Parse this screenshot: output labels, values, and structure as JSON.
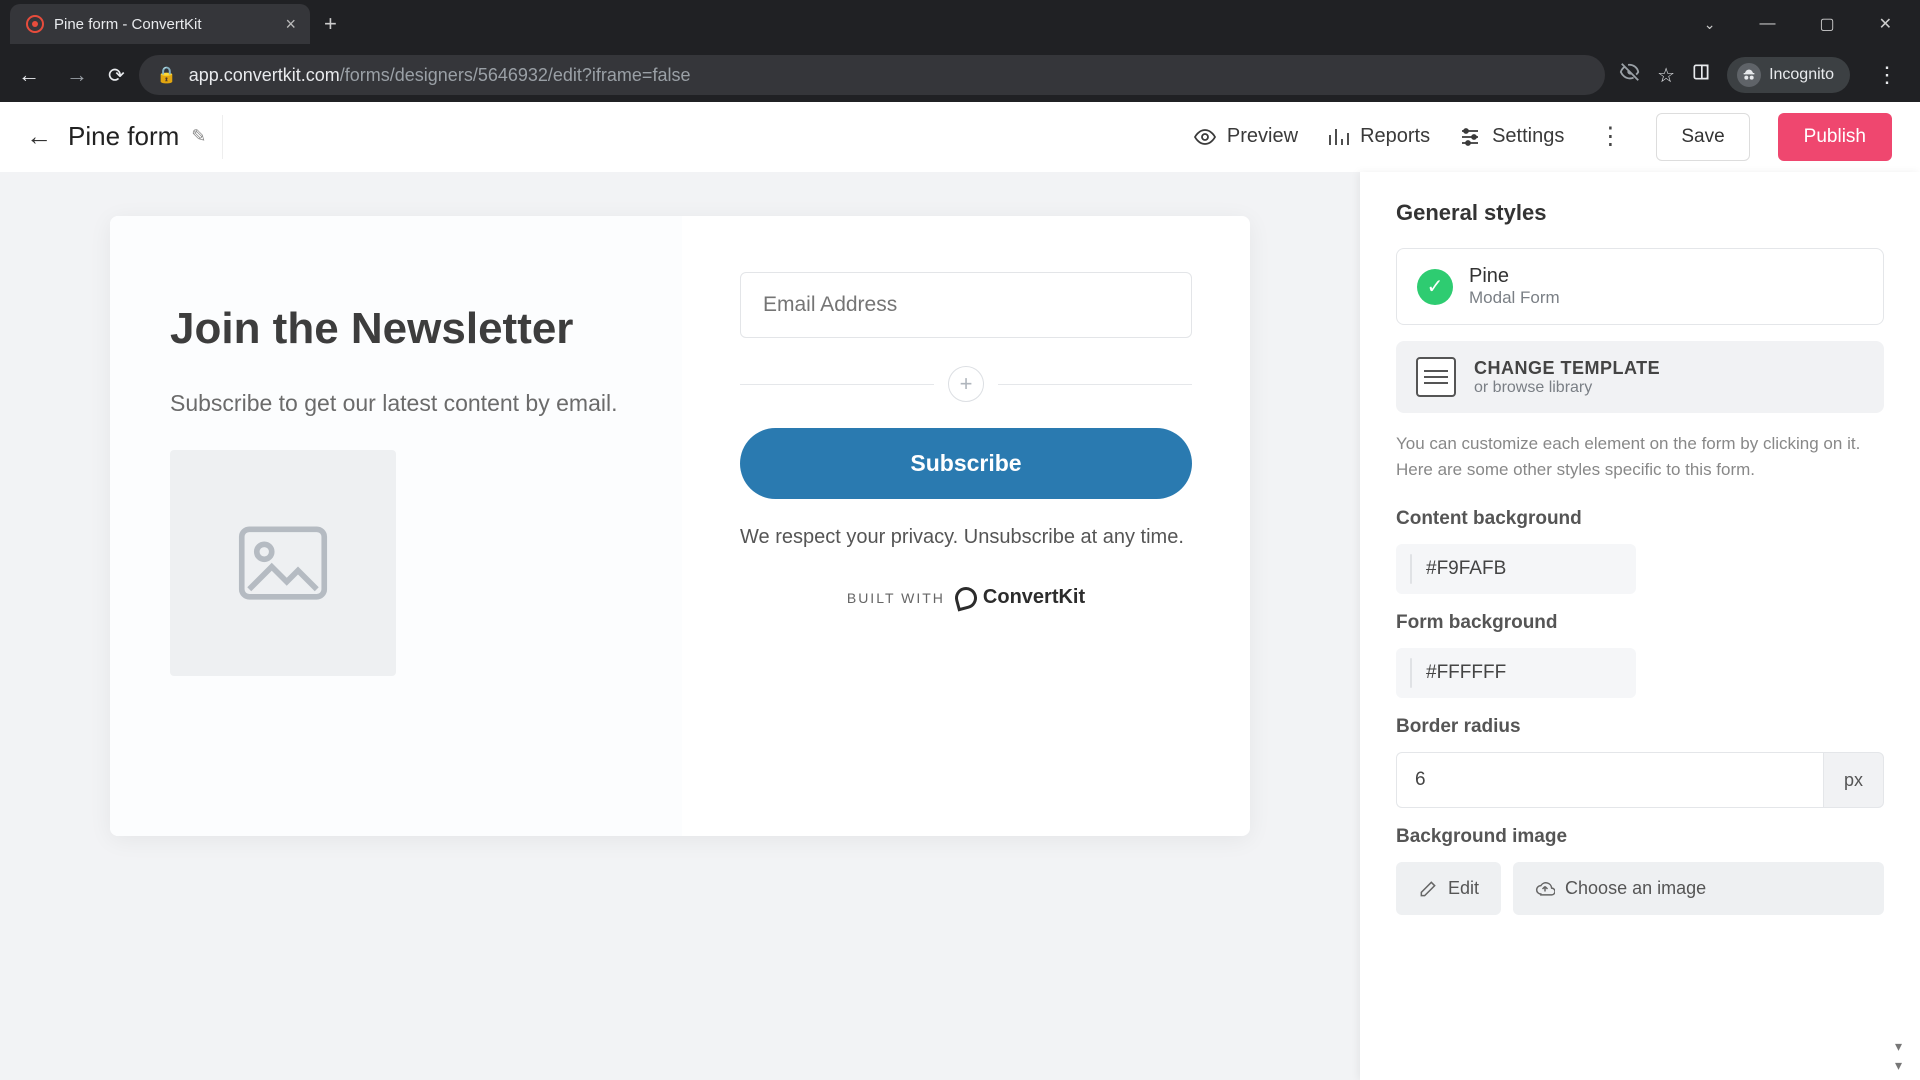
{
  "browser": {
    "tab_title": "Pine form - ConvertKit",
    "url_domain": "app.convertkit.com",
    "url_path": "/forms/designers/5646932/edit?iframe=false",
    "incognito_label": "Incognito"
  },
  "header": {
    "form_name": "Pine form",
    "preview": "Preview",
    "reports": "Reports",
    "settings": "Settings",
    "save": "Save",
    "publish": "Publish"
  },
  "form_preview": {
    "heading": "Join the Newsletter",
    "subheading": "Subscribe to get our latest content by email.",
    "email_placeholder": "Email Address",
    "subscribe_label": "Subscribe",
    "privacy": "We respect your privacy. Unsubscribe at any time.",
    "built_with_prefix": "BUILT WITH",
    "brand": "ConvertKit"
  },
  "panel": {
    "title": "General styles",
    "template": {
      "name": "Pine",
      "type": "Modal Form"
    },
    "change_template": {
      "title": "CHANGE TEMPLATE",
      "sub": "or browse library"
    },
    "help": "You can customize each element on the form by clicking on it. Here are some other styles specific to this form.",
    "content_bg": {
      "label": "Content background",
      "value": "#F9FAFB"
    },
    "form_bg": {
      "label": "Form background",
      "value": "#FFFFFF"
    },
    "border_radius": {
      "label": "Border radius",
      "value": "6",
      "unit": "px"
    },
    "bg_image": {
      "label": "Background image",
      "edit": "Edit",
      "choose": "Choose an image"
    }
  }
}
